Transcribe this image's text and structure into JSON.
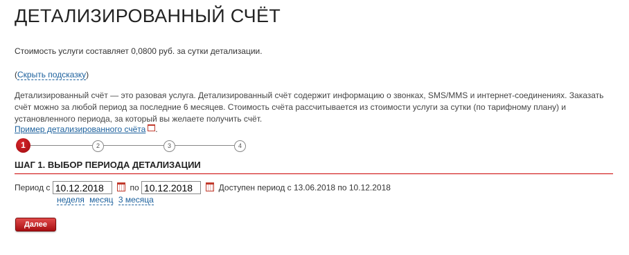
{
  "page": {
    "title": "ДЕТАЛИЗИРОВАННЫЙ СЧЁТ",
    "cost_text": "Стоимость услуги составляет 0,0800 руб. за сутки детализации."
  },
  "hint": {
    "open_paren": "(",
    "toggle_label": "Скрыть подсказку",
    "close_paren": ")",
    "text": "Детализированный счёт — это разовая услуга. Детализированный счёт содержит информацию о звонках, SMS/MMS и интернет-соединениях. Заказать счёт можно за любой период за последние 6 месяцев. Стоимость счёта рассчитывается из стоимости услуги за сутки (по тарифному плану) и установленного периода, за который вы желаете получить счёт.",
    "example_link": "Пример детализированного счёта",
    "example_suffix": "."
  },
  "steps": {
    "items": [
      "1",
      "2",
      "3",
      "4"
    ],
    "active": 1,
    "heading": "ШАГ 1. ВЫБОР ПЕРИОДА ДЕТАЛИЗАЦИИ"
  },
  "period": {
    "from_label": "Период с",
    "from_value": "10.12.2018",
    "to_label": "по",
    "to_value": "10.12.2018",
    "available_text": "Доступен период с 13.06.2018 по 10.12.2018",
    "quick": [
      "неделя",
      "месяц",
      "3 месяца"
    ]
  },
  "actions": {
    "submit_label": "Далее"
  },
  "colors": {
    "accent": "#c00000",
    "link": "#1a5f9c"
  }
}
